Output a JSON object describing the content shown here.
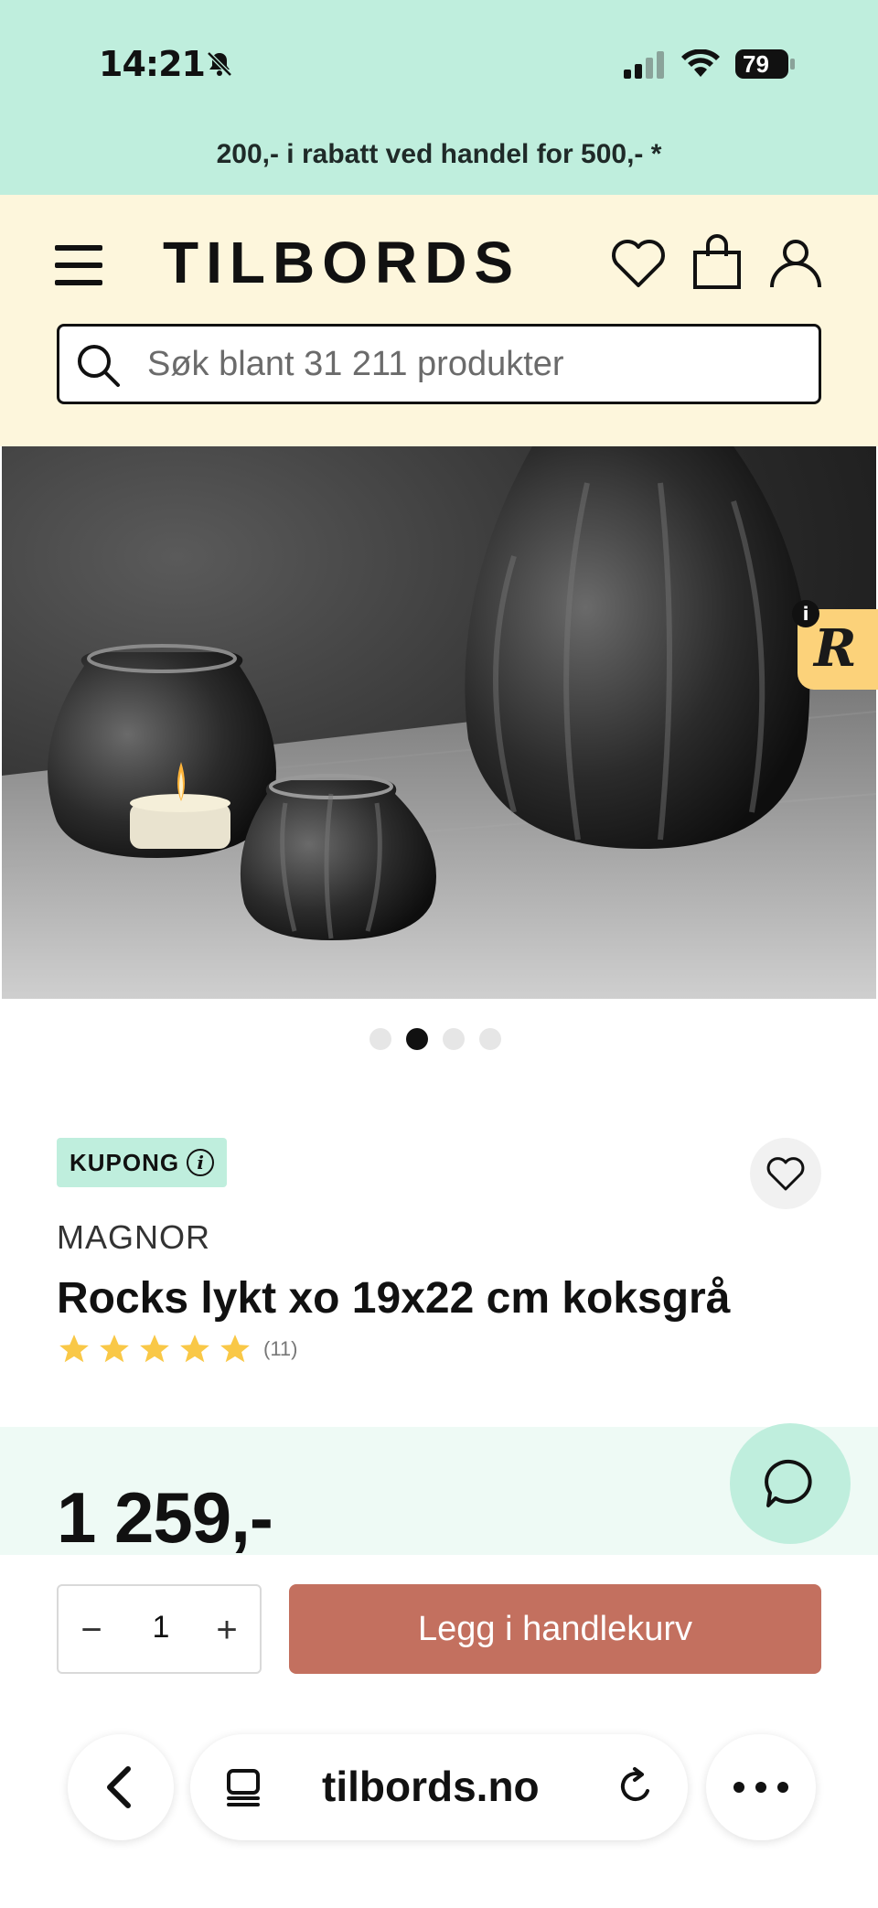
{
  "status_bar": {
    "time": "14:21",
    "battery": "79"
  },
  "promo": {
    "text": "200,- i rabatt ved handel for 500,- *"
  },
  "header": {
    "logo": "TILBORDS"
  },
  "search": {
    "placeholder": "Søk blant 31 211 produkter"
  },
  "gallery": {
    "slide_count": 4,
    "active_slide": 2
  },
  "product": {
    "badge": "KUPONG",
    "brand": "MAGNOR",
    "title": "Rocks lykt xo 19x22 cm koksgrå",
    "rating": 5,
    "rating_count": "(11)",
    "price": "1 259,-"
  },
  "cart": {
    "quantity": "1",
    "minus": "−",
    "plus": "+",
    "add_label": "Legg i handlekurv"
  },
  "browser": {
    "url": "tilbords.no"
  },
  "colors": {
    "mint": "#bfeedd",
    "cream": "#fdf6dc",
    "cta": "#c3705f",
    "star": "#f9c847"
  }
}
